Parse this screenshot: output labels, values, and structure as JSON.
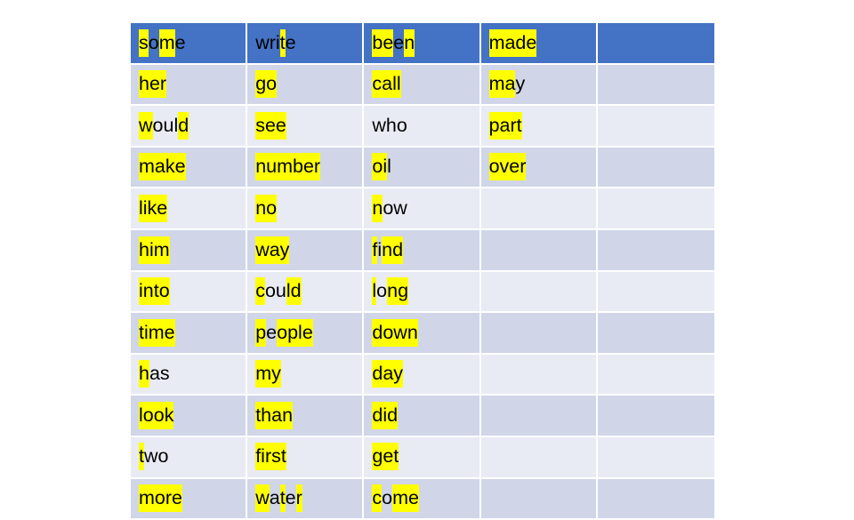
{
  "page": {
    "title": "Sight Words Table",
    "background_color": "#ffffff",
    "highlight_color": "#ffff00",
    "header_row_color": "#4472c4",
    "band_a_color": "#d0d6e8",
    "band_b_color": "#e8ebf4",
    "gridline_color": "#ffffff",
    "text_color": "#000000"
  },
  "table": {
    "columns": 5,
    "visible_rows": 13,
    "last_row_clipped": true,
    "rows": [
      {
        "style": "header",
        "cells": [
          {
            "word": "some",
            "segments": [
              {
                "t": "s",
                "h": true
              },
              {
                "t": "o",
                "h": false
              },
              {
                "t": "m",
                "h": true
              },
              {
                "t": "e",
                "h": false
              }
            ]
          },
          {
            "word": "write",
            "segments": [
              {
                "t": "wri",
                "h": false
              },
              {
                "t": "t",
                "h": true
              },
              {
                "t": "e",
                "h": false
              }
            ]
          },
          {
            "word": "been",
            "segments": [
              {
                "t": "be",
                "h": true
              },
              {
                "t": "e",
                "h": false
              },
              {
                "t": "n",
                "h": true
              }
            ]
          },
          {
            "word": "made",
            "segments": [
              {
                "t": "made",
                "h": true
              }
            ]
          },
          {
            "word": "",
            "segments": []
          }
        ]
      },
      {
        "style": "band-a",
        "cells": [
          {
            "word": "her",
            "segments": [
              {
                "t": "her",
                "h": true
              }
            ]
          },
          {
            "word": "go",
            "segments": [
              {
                "t": "go",
                "h": true
              }
            ]
          },
          {
            "word": "call",
            "segments": [
              {
                "t": "ca",
                "h": true
              },
              {
                "t": "",
                "h": false
              },
              {
                "t": "ll",
                "h": true
              }
            ]
          },
          {
            "word": "may",
            "segments": [
              {
                "t": "ma",
                "h": true
              },
              {
                "t": "y",
                "h": false
              }
            ]
          },
          {
            "word": "",
            "segments": []
          }
        ]
      },
      {
        "style": "band-b",
        "cells": [
          {
            "word": "would",
            "segments": [
              {
                "t": "w",
                "h": true
              },
              {
                "t": "oul",
                "h": false
              },
              {
                "t": "d",
                "h": true
              }
            ]
          },
          {
            "word": "see",
            "segments": [
              {
                "t": "see",
                "h": true
              }
            ]
          },
          {
            "word": "who",
            "segments": [
              {
                "t": "who",
                "h": false
              }
            ]
          },
          {
            "word": "part",
            "segments": [
              {
                "t": "part",
                "h": true
              }
            ]
          },
          {
            "word": "",
            "segments": []
          }
        ]
      },
      {
        "style": "band-a",
        "cells": [
          {
            "word": "make",
            "segments": [
              {
                "t": "make",
                "h": true
              }
            ]
          },
          {
            "word": "number",
            "segments": [
              {
                "t": "number",
                "h": true
              }
            ]
          },
          {
            "word": "oil",
            "segments": [
              {
                "t": "oi",
                "h": true
              },
              {
                "t": "l",
                "h": false
              }
            ]
          },
          {
            "word": "over",
            "segments": [
              {
                "t": "over",
                "h": true
              }
            ]
          },
          {
            "word": "",
            "segments": []
          }
        ]
      },
      {
        "style": "band-b",
        "cells": [
          {
            "word": "like",
            "segments": [
              {
                "t": "like",
                "h": true
              }
            ]
          },
          {
            "word": "no",
            "segments": [
              {
                "t": "no",
                "h": true
              }
            ]
          },
          {
            "word": "now",
            "segments": [
              {
                "t": "n",
                "h": true
              },
              {
                "t": "ow",
                "h": false
              }
            ]
          },
          {
            "word": "",
            "segments": []
          },
          {
            "word": "",
            "segments": []
          }
        ]
      },
      {
        "style": "band-a",
        "cells": [
          {
            "word": "him",
            "segments": [
              {
                "t": "him",
                "h": true
              }
            ]
          },
          {
            "word": "way",
            "segments": [
              {
                "t": "way",
                "h": true
              }
            ]
          },
          {
            "word": "find",
            "segments": [
              {
                "t": "f",
                "h": true
              },
              {
                "t": "i",
                "h": false
              },
              {
                "t": "nd",
                "h": true
              }
            ]
          },
          {
            "word": "",
            "segments": []
          },
          {
            "word": "",
            "segments": []
          }
        ]
      },
      {
        "style": "band-b",
        "cells": [
          {
            "word": "into",
            "segments": [
              {
                "t": "into",
                "h": true
              }
            ]
          },
          {
            "word": "could",
            "segments": [
              {
                "t": "c",
                "h": true
              },
              {
                "t": "ou",
                "h": false
              },
              {
                "t": "ld",
                "h": true
              }
            ]
          },
          {
            "word": "long",
            "segments": [
              {
                "t": "l",
                "h": true
              },
              {
                "t": "o",
                "h": false
              },
              {
                "t": "ng",
                "h": true
              }
            ]
          },
          {
            "word": "",
            "segments": []
          },
          {
            "word": "",
            "segments": []
          }
        ]
      },
      {
        "style": "band-a",
        "cells": [
          {
            "word": "time",
            "segments": [
              {
                "t": "time",
                "h": true
              }
            ]
          },
          {
            "word": "people",
            "segments": [
              {
                "t": "p",
                "h": true
              },
              {
                "t": "e",
                "h": false
              },
              {
                "t": "ople",
                "h": true
              }
            ]
          },
          {
            "word": "down",
            "segments": [
              {
                "t": "down",
                "h": true
              }
            ]
          },
          {
            "word": "",
            "segments": []
          },
          {
            "word": "",
            "segments": []
          }
        ]
      },
      {
        "style": "band-b",
        "cells": [
          {
            "word": "has",
            "segments": [
              {
                "t": "h",
                "h": true
              },
              {
                "t": "as",
                "h": false
              }
            ]
          },
          {
            "word": "my",
            "segments": [
              {
                "t": "my",
                "h": true
              }
            ]
          },
          {
            "word": "day",
            "segments": [
              {
                "t": "day",
                "h": true
              }
            ]
          },
          {
            "word": "",
            "segments": []
          },
          {
            "word": "",
            "segments": []
          }
        ]
      },
      {
        "style": "band-a",
        "cells": [
          {
            "word": "look",
            "segments": [
              {
                "t": "look",
                "h": true
              }
            ]
          },
          {
            "word": "than",
            "segments": [
              {
                "t": "than",
                "h": true
              }
            ]
          },
          {
            "word": "did",
            "segments": [
              {
                "t": "did",
                "h": true
              }
            ]
          },
          {
            "word": "",
            "segments": []
          },
          {
            "word": "",
            "segments": []
          }
        ]
      },
      {
        "style": "band-b",
        "cells": [
          {
            "word": "two",
            "segments": [
              {
                "t": "t",
                "h": true
              },
              {
                "t": "wo",
                "h": false
              }
            ]
          },
          {
            "word": "first",
            "segments": [
              {
                "t": "first",
                "h": true
              }
            ]
          },
          {
            "word": "get",
            "segments": [
              {
                "t": "get",
                "h": true
              }
            ]
          },
          {
            "word": "",
            "segments": []
          },
          {
            "word": "",
            "segments": []
          }
        ]
      },
      {
        "style": "band-a",
        "cells": [
          {
            "word": "more",
            "segments": [
              {
                "t": "more",
                "h": true
              }
            ]
          },
          {
            "word": "water",
            "segments": [
              {
                "t": "w",
                "h": true
              },
              {
                "t": "a",
                "h": false
              },
              {
                "t": "t",
                "h": true
              },
              {
                "t": "e",
                "h": false
              },
              {
                "t": "r",
                "h": true
              }
            ]
          },
          {
            "word": "come",
            "segments": [
              {
                "t": "c",
                "h": true
              },
              {
                "t": "o",
                "h": false
              },
              {
                "t": "me",
                "h": true
              }
            ]
          },
          {
            "word": "",
            "segments": []
          },
          {
            "word": "",
            "segments": []
          }
        ]
      }
    ]
  }
}
